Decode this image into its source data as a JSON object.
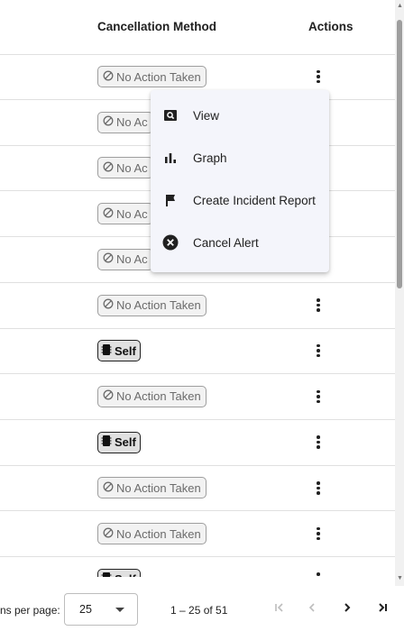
{
  "header": {
    "cancellation_method": "Cancellation Method",
    "actions": "Actions"
  },
  "rows": [
    {
      "method": "No Action Taken",
      "type": "none"
    },
    {
      "method": "No Ac",
      "type": "none"
    },
    {
      "method": "No Ac",
      "type": "none"
    },
    {
      "method": "No Ac",
      "type": "none"
    },
    {
      "method": "No Ac",
      "type": "none"
    },
    {
      "method": "No Action Taken",
      "type": "none"
    },
    {
      "method": "Self",
      "type": "self"
    },
    {
      "method": "No Action Taken",
      "type": "none"
    },
    {
      "method": "Self",
      "type": "self"
    },
    {
      "method": "No Action Taken",
      "type": "none"
    },
    {
      "method": "No Action Taken",
      "type": "none"
    },
    {
      "method": "Self",
      "type": "self"
    }
  ],
  "menu": {
    "items": [
      {
        "label": "View",
        "icon": "search-box-icon"
      },
      {
        "label": "Graph",
        "icon": "bar-chart-icon"
      },
      {
        "label": "Create Incident Report",
        "icon": "flag-icon"
      },
      {
        "label": "Cancel Alert",
        "icon": "cancel-circle-icon"
      }
    ]
  },
  "pagination": {
    "items_per_page_label": "ns per page:",
    "page_size": "25",
    "range": "1 – 25 of 51"
  }
}
